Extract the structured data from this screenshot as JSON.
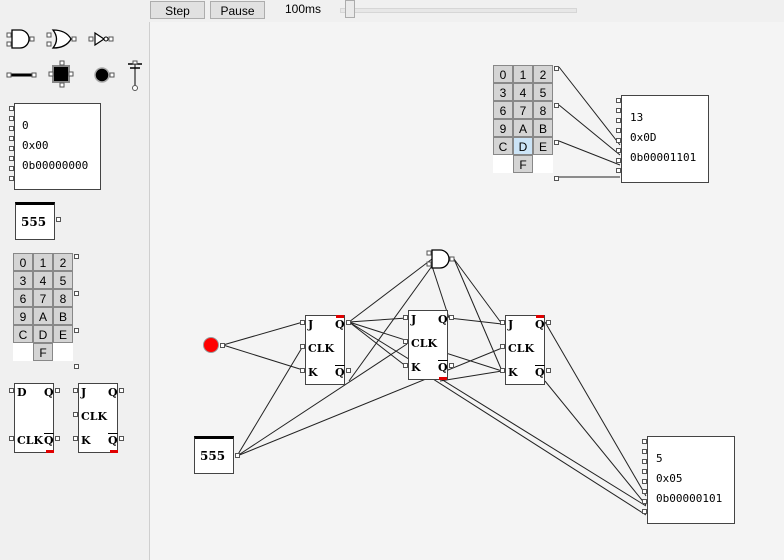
{
  "toolbar": {
    "step_label": "Step",
    "pause_label": "Pause",
    "speed_label": "100ms",
    "speed_fraction": 0.02
  },
  "palette": {
    "display": {
      "dec": "0",
      "hex": "0x00",
      "bin": "0b00000000"
    },
    "timer_label": "555",
    "keypad": [
      "0",
      "1",
      "2",
      "3",
      "4",
      "5",
      "6",
      "7",
      "8",
      "9",
      "A",
      "B",
      "C",
      "D",
      "E",
      "F"
    ],
    "d_ff": {
      "d": "D",
      "q": "Q",
      "clk": "CLK",
      "qbar": "Q"
    },
    "jk_ff": {
      "j": "J",
      "q": "Q",
      "clk": "CLK",
      "k": "K",
      "qbar": "Q"
    }
  },
  "canvas": {
    "keypad": [
      "0",
      "1",
      "2",
      "3",
      "4",
      "5",
      "6",
      "7",
      "8",
      "9",
      "A",
      "B",
      "C",
      "D",
      "E",
      "F"
    ],
    "keypad_selected": "D",
    "top_display": {
      "dec": "13",
      "hex": "0x0D",
      "bin": "0b00001101"
    },
    "bottom_display": {
      "dec": "5",
      "hex": "0x05",
      "bin": "0b00000101"
    },
    "timer_label": "555",
    "ff1": {
      "j": "J",
      "q": "Q",
      "clk": "CLK",
      "k": "K",
      "qbar": "Q"
    },
    "ff2": {
      "j": "J",
      "q": "Q",
      "clk": "CLK",
      "k": "K",
      "qbar": "Q"
    },
    "ff3": {
      "j": "J",
      "q": "Q",
      "clk": "CLK",
      "k": "K",
      "qbar": "Q"
    }
  },
  "colors": {
    "led_on": "#ff0000",
    "active_pin": "#e00000",
    "keypad_selected": "#cce4f7"
  }
}
